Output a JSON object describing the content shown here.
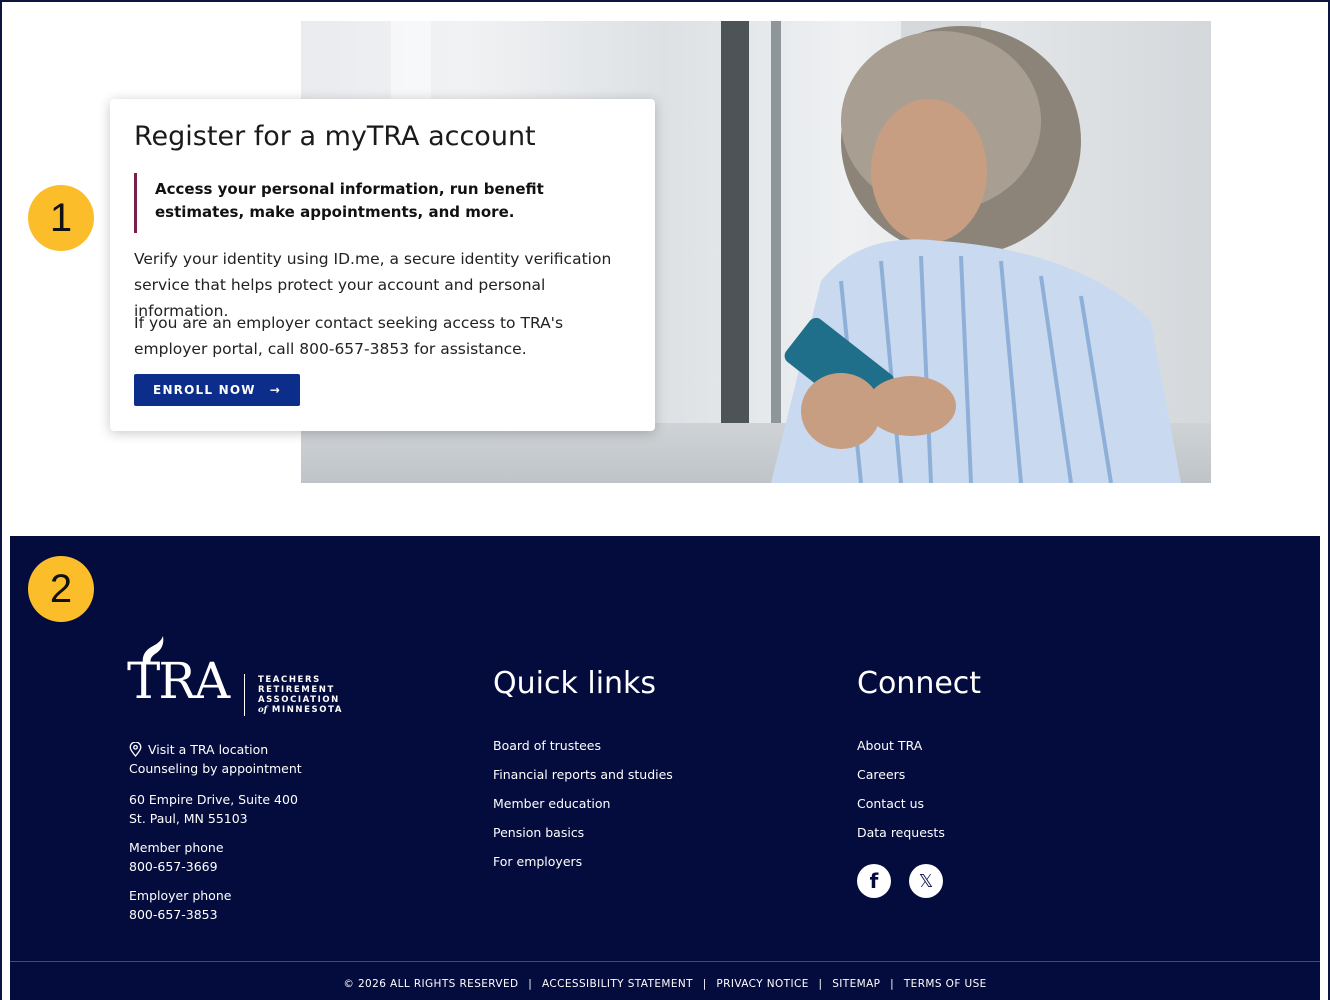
{
  "callouts": [
    "1",
    "2"
  ],
  "hero": {
    "title": "Register for a myTRA account",
    "quote": "Access your personal information, run benefit estimates, make appointments, and more.",
    "paragraph1": "Verify your identity using ID.me, a secure identity verification service that helps protect your account and personal information.",
    "paragraph2": "If you are an employer contact seeking access to TRA's employer portal, call 800-657-3853 for assistance.",
    "cta_label": "ENROLL NOW",
    "cta_arrow": "→"
  },
  "footer": {
    "logo": {
      "wordmark": "TRA",
      "line1": "TEACHERS",
      "line2": "RETIREMENT",
      "line3": "ASSOCIATION",
      "line4_of": "of",
      "line4": "MINNESOTA"
    },
    "contact": {
      "location_link": "Visit a TRA location",
      "counseling": "Counseling by appointment",
      "address_line1": "60 Empire Drive, Suite 400",
      "address_line2": "St. Paul, MN 55103",
      "member_phone_label": "Member phone",
      "member_phone": "800-657-3669",
      "employer_phone_label": "Employer phone",
      "employer_phone": "800-657-3853"
    },
    "quick_links": {
      "title": "Quick links",
      "items": [
        "Board of trustees",
        "Financial reports and studies",
        "Member education",
        "Pension basics",
        "For employers"
      ]
    },
    "connect": {
      "title": "Connect",
      "items": [
        "About TRA",
        "Careers",
        "Contact us",
        "Data requests"
      ],
      "social": [
        {
          "name": "facebook-icon",
          "glyph": "f"
        },
        {
          "name": "x-icon",
          "glyph": "𝕏"
        }
      ]
    },
    "legal": {
      "copyright": "© 2026 ALL RIGHTS RESERVED",
      "sep": "|",
      "links": [
        "ACCESSIBILITY STATEMENT",
        "PRIVACY NOTICE",
        "SITEMAP",
        "TERMS OF USE"
      ]
    }
  },
  "colors": {
    "footer_bg": "#040c3e",
    "button_bg": "#0d2d8a",
    "quote_bar": "#7a1f4c",
    "callout": "#fbbd2a"
  }
}
